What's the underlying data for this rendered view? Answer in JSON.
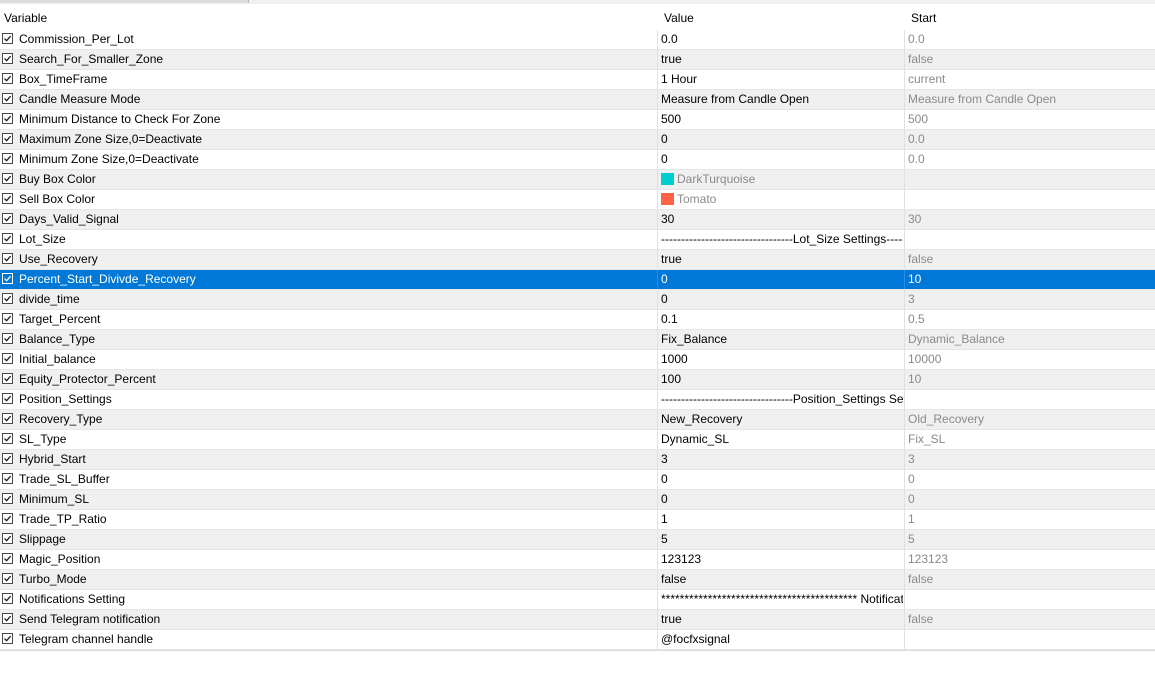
{
  "columns": {
    "variable": "Variable",
    "value": "Value",
    "start": "Start"
  },
  "rows": [
    {
      "name": "Commission_Per_Lot",
      "value": "0.0",
      "start": "0.0"
    },
    {
      "name": "Search_For_Smaller_Zone",
      "value": "true",
      "start": "false"
    },
    {
      "name": "Box_TimeFrame",
      "value": "1 Hour",
      "start": "current"
    },
    {
      "name": "Candle Measure Mode",
      "value": "Measure from Candle Open",
      "start": "Measure from Candle Open"
    },
    {
      "name": "Minimum Distance to Check For Zone",
      "value": "500",
      "start": "500"
    },
    {
      "name": "Maximum Zone Size,0=Deactivate",
      "value": "0",
      "start": "0.0"
    },
    {
      "name": "Minimum Zone Size,0=Deactivate",
      "value": "0",
      "start": "0.0"
    },
    {
      "name": "Buy Box Color",
      "value": "DarkTurquoise",
      "start": "",
      "swatch": "#00ced1"
    },
    {
      "name": "Sell Box Color",
      "value": "Tomato",
      "start": "",
      "swatch": "#ff6347"
    },
    {
      "name": "Days_Valid_Signal",
      "value": "30",
      "start": "30"
    },
    {
      "name": "Lot_Size",
      "value": "---------------------------------Lot_Size Settings-------------",
      "start": ""
    },
    {
      "name": "Use_Recovery",
      "value": "true",
      "start": "false"
    },
    {
      "name": "Percent_Start_Divivde_Recovery",
      "value": "0",
      "start": "10",
      "selected": true
    },
    {
      "name": "divide_time",
      "value": "0",
      "start": "3"
    },
    {
      "name": "Target_Percent",
      "value": "0.1",
      "start": "0.5"
    },
    {
      "name": "Balance_Type",
      "value": "Fix_Balance",
      "start": "Dynamic_Balance"
    },
    {
      "name": "Initial_balance",
      "value": "1000",
      "start": "10000"
    },
    {
      "name": "Equity_Protector_Percent",
      "value": "100",
      "start": "10"
    },
    {
      "name": "Position_Settings",
      "value": "---------------------------------Position_Settings Settings----",
      "start": ""
    },
    {
      "name": "Recovery_Type",
      "value": "New_Recovery",
      "start": "Old_Recovery"
    },
    {
      "name": "SL_Type",
      "value": "Dynamic_SL",
      "start": "Fix_SL"
    },
    {
      "name": "Hybrid_Start",
      "value": "3",
      "start": "3"
    },
    {
      "name": "Trade_SL_Buffer",
      "value": "0",
      "start": "0"
    },
    {
      "name": "Minimum_SL",
      "value": "0",
      "start": "0"
    },
    {
      "name": "Trade_TP_Ratio",
      "value": "1",
      "start": "1"
    },
    {
      "name": "Slippage",
      "value": "5",
      "start": "5"
    },
    {
      "name": "Magic_Position",
      "value": "123123",
      "start": "123123"
    },
    {
      "name": "Turbo_Mode",
      "value": "false",
      "start": "false"
    },
    {
      "name": "Notifications Setting",
      "value": "****************************************** Notifications Settin",
      "start": ""
    },
    {
      "name": "Send Telegram notification",
      "value": "true",
      "start": "false"
    },
    {
      "name": "Telegram channel handle",
      "value": "@focfxsignal",
      "start": ""
    }
  ],
  "icons": {
    "checkbox": "checkbox-checked-icon",
    "swatch": "color-swatch-icon"
  },
  "colors": {
    "selection": "#0078d7",
    "alt_row": "#f0f0f0",
    "start_text": "#8a8a8a"
  }
}
